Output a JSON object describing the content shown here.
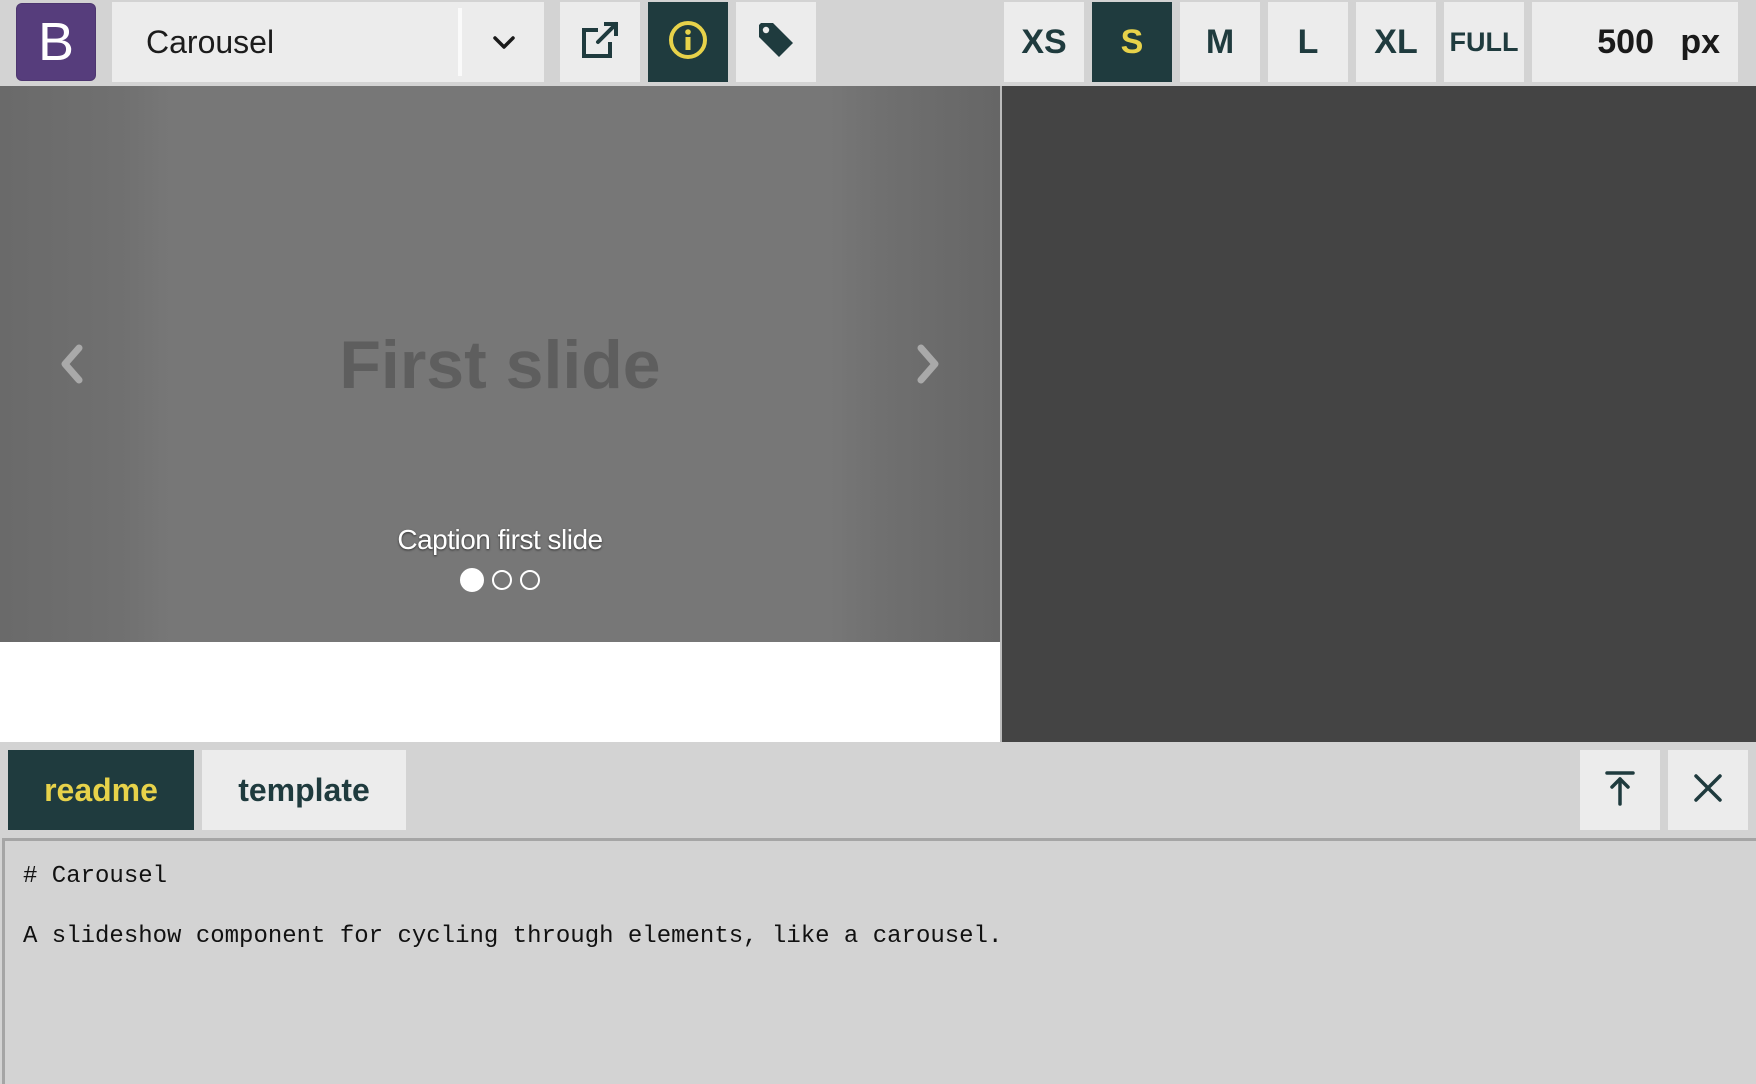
{
  "brand": {
    "letter": "B",
    "color": "#563d7c"
  },
  "component_select": {
    "value": "Carousel",
    "caret_icon": "chevron-down-icon"
  },
  "toolbar": {
    "icons": [
      "external-link-icon",
      "info-icon",
      "tag-icon"
    ],
    "active_icon": "info-icon"
  },
  "sizes": {
    "items": [
      "XS",
      "S",
      "M",
      "L",
      "XL",
      "FULL"
    ],
    "active": "S"
  },
  "width": {
    "value": "500",
    "unit": "px"
  },
  "carousel": {
    "slide_title": "First slide",
    "caption": "Caption first slide",
    "slide_count": 3,
    "active_index": 0
  },
  "tabs": {
    "items": [
      "readme",
      "template"
    ],
    "active": "readme"
  },
  "pane_buttons": [
    "move-to-top-icon",
    "close-icon"
  ],
  "readme": {
    "lines": [
      "# Carousel",
      "A slideshow component for cycling through elements, like a carousel."
    ]
  },
  "colors": {
    "accent_dark": "#1f3b3e",
    "accent_yellow": "#e7d24a",
    "panel_dark": "#444444"
  }
}
